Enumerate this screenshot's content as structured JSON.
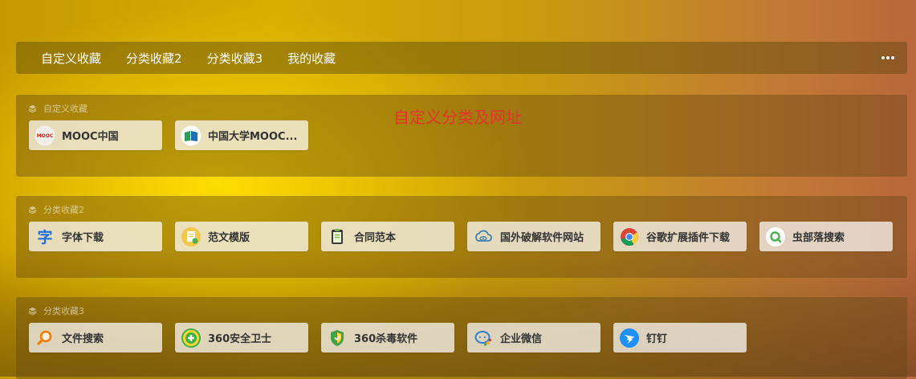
{
  "nav": {
    "tabs": [
      "自定义收藏",
      "分类收藏2",
      "分类收藏3",
      "我的收藏"
    ],
    "more_icon": "more-dots-icon"
  },
  "annotation": "自定义分类及网址",
  "sections": [
    {
      "title": "自定义收藏",
      "items": [
        {
          "label": "MOOC中国",
          "icon": "mooc-china-logo-icon"
        },
        {
          "label": "中国大学MOOC...",
          "icon": "china-university-mooc-icon"
        }
      ]
    },
    {
      "title": "分类收藏2",
      "items": [
        {
          "label": "字体下载",
          "icon": "font-char-icon"
        },
        {
          "label": "范文模版",
          "icon": "document-template-icon"
        },
        {
          "label": "合同范本",
          "icon": "contract-clipboard-icon"
        },
        {
          "label": "国外破解软件网站",
          "icon": "cloud-eye-icon"
        },
        {
          "label": "谷歌扩展插件下载",
          "icon": "chrome-icon"
        },
        {
          "label": "虫部落搜索",
          "icon": "green-search-icon"
        }
      ]
    },
    {
      "title": "分类收藏3",
      "items": [
        {
          "label": "文件搜索",
          "icon": "orange-search-icon"
        },
        {
          "label": "360安全卫士",
          "icon": "360-guard-icon"
        },
        {
          "label": "360杀毒软件",
          "icon": "360-shield-icon"
        },
        {
          "label": "企业微信",
          "icon": "wecom-icon"
        },
        {
          "label": "钉钉",
          "icon": "dingtalk-icon"
        }
      ]
    }
  ]
}
